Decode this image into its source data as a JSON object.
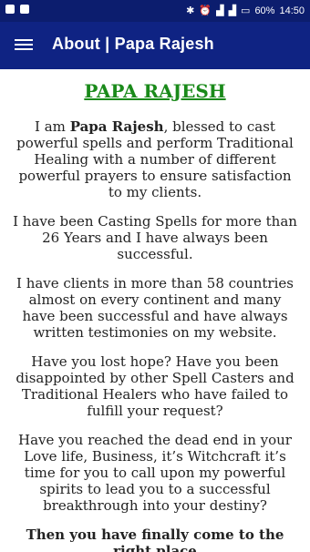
{
  "status_bar": {
    "battery": "60%",
    "time": "14:50"
  },
  "app_bar": {
    "menu_icon": "hamburger-menu-icon",
    "title": "About | Papa Rajesh"
  },
  "content": {
    "heading": "PAPA RAJESH",
    "intro_prefix": "I am ",
    "intro_name": "Papa Rajesh",
    "intro_rest": ", blessed to cast powerful spells and perform Traditional Healing with a number of different powerful prayers to ensure satisfaction to my clients.",
    "p2": "I have been Casting Spells for more than 26 Years and I have always been successful.",
    "p3": "I have clients in more than 58 countries almost on every continent and many have been successful and have always written testimonies on my website.",
    "p4": "Have you lost hope? Have you been disappointed by other Spell Casters and Traditional Healers who have failed to fulfill your request?",
    "p5": "Have you reached the dead end in your Love life, Business, it’s Witchcraft it’s time for you to call upon my powerful spirits to lead you to a successful breakthrough into your destiny?",
    "p6": "Then you have finally come to the right place"
  },
  "colors": {
    "status_bar": "#0c1d6e",
    "app_bar": "#0f2383",
    "heading": "#1a8a1a"
  }
}
